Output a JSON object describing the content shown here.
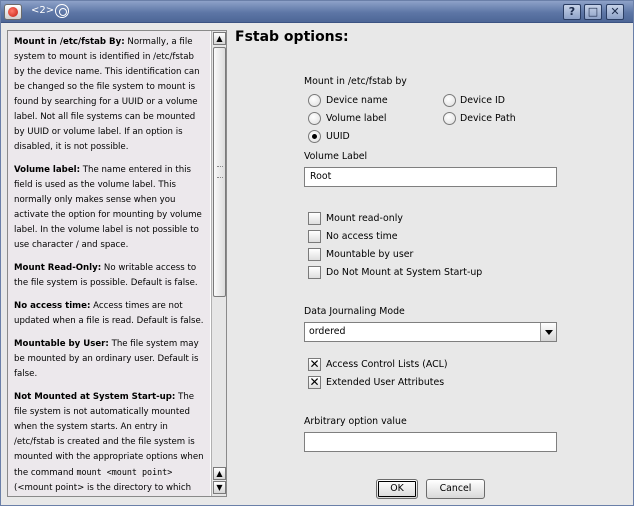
{
  "window": {
    "title": "<2>",
    "buttons": {
      "help": "?",
      "maximize": "□",
      "close": "✕"
    }
  },
  "help": {
    "paragraphs": [
      {
        "term": "Mount in /etc/fstab By:",
        "text": " Normally, a file system to mount is identified in /etc/fstab by the device name. This identification can be changed so the file system to mount is found by searching for a UUID or a volume label. Not all file systems can be mounted by UUID or volume label. If an option is disabled, it is not possible."
      },
      {
        "term": "Volume label:",
        "text": " The name entered in this field is used as the volume label. This normally only makes sense when you activate the option for mounting by volume label. In the volume label is not possible to use character / and space."
      },
      {
        "term": "Mount Read-Only:",
        "text": " No writable access to the file system is possible. Default is false."
      },
      {
        "term": "No access time:",
        "text": " Access times are not updated when a file is read. Default is false."
      },
      {
        "term": "Mountable by User:",
        "text": " The file system may be mounted by an ordinary user. Default is false."
      },
      {
        "term": "Not Mounted at System Start-up:",
        "text": " The file system is not automatically mounted when the system starts. An entry in /etc/fstab is created and the file system is mounted with the appropriate options when the command ",
        "code": "mount <mount point>",
        "tail": " (<mount point> is the directory to which the file system is mounted) is given. Default is false."
      }
    ]
  },
  "form": {
    "heading": "Fstab options:",
    "mount_by_label": "Mount in /etc/fstab by",
    "mount_by_options": [
      {
        "label": "Device name",
        "checked": false
      },
      {
        "label": "Device ID",
        "checked": false
      },
      {
        "label": "Volume label",
        "checked": false
      },
      {
        "label": "Device Path",
        "checked": false
      },
      {
        "label": "UUID",
        "checked": true
      }
    ],
    "volume_label_caption": "Volume Label",
    "volume_label_value": "Root",
    "checkboxes": [
      {
        "label": "Mount read-only",
        "checked": false
      },
      {
        "label": "No access time",
        "checked": false
      },
      {
        "label": "Mountable by user",
        "checked": false
      },
      {
        "label": "Do Not Mount at System Start-up",
        "checked": false
      }
    ],
    "journaling_caption": "Data Journaling Mode",
    "journaling_value": "ordered",
    "acl_checkboxes": [
      {
        "label": "Access Control Lists (ACL)",
        "checked": true
      },
      {
        "label": "Extended User Attributes",
        "checked": true
      }
    ],
    "arbitrary_caption": "Arbitrary option value",
    "arbitrary_value": "",
    "ok_label": "OK",
    "cancel_label": "Cancel"
  }
}
